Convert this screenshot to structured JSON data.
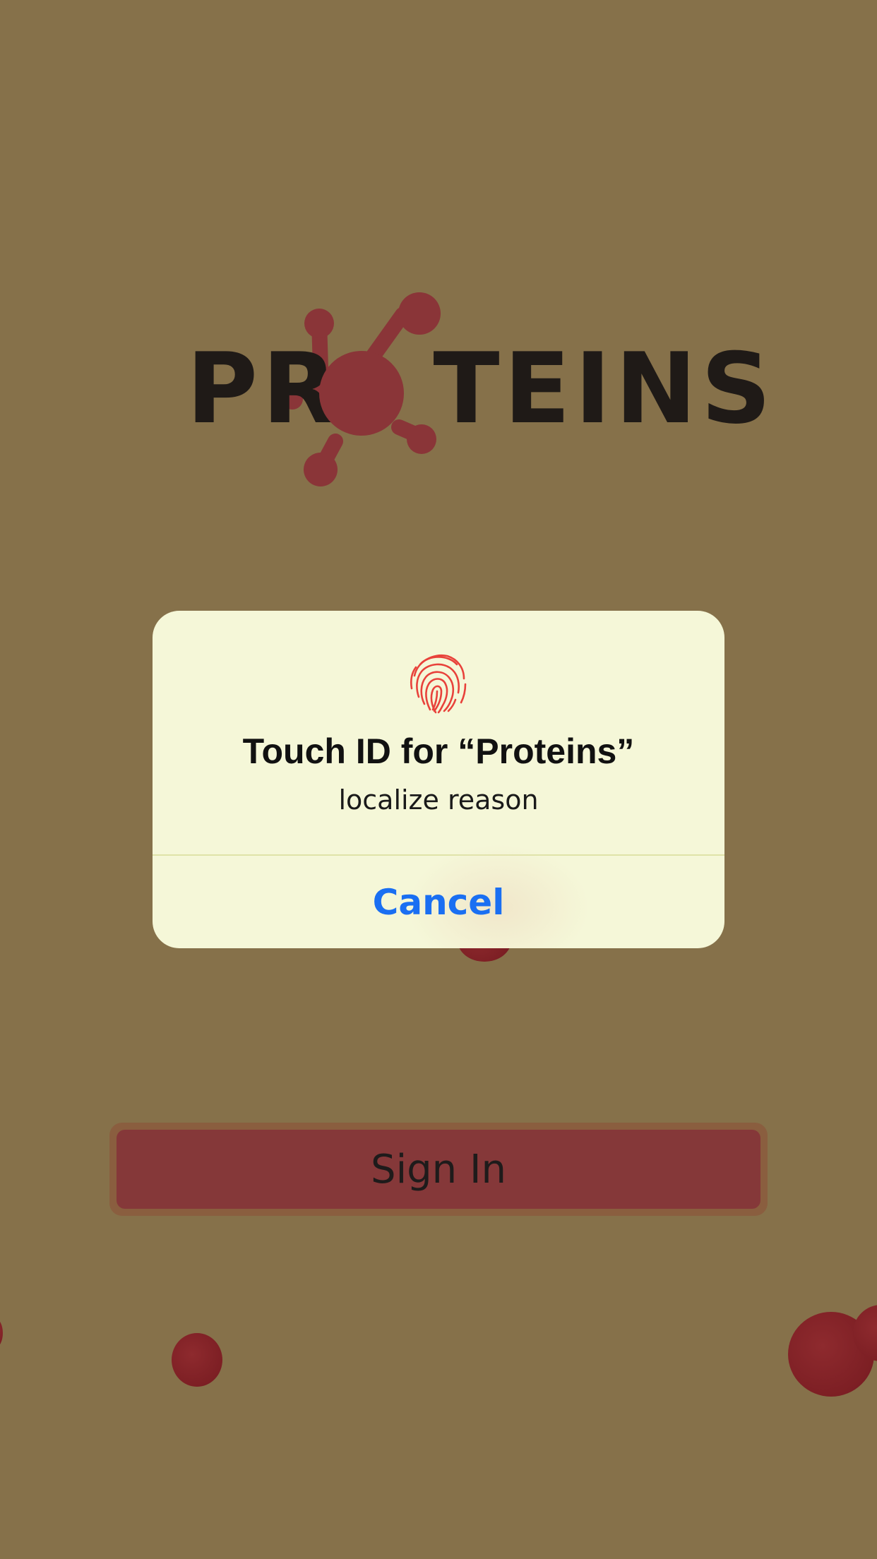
{
  "app": {
    "logo_text_left": "PR",
    "logo_text_right": "TEINS",
    "logo_name": "PROTEINS"
  },
  "alert": {
    "icon": "fingerprint-icon",
    "title": "Touch ID for “Proteins”",
    "message": "localize reason",
    "cancel_label": "Cancel"
  },
  "signin": {
    "label": "Sign In"
  },
  "colors": {
    "background": "#86714a",
    "accent_red": "#853839",
    "alert_background": "#f5f7d8",
    "link_blue": "#1a6ff2"
  }
}
